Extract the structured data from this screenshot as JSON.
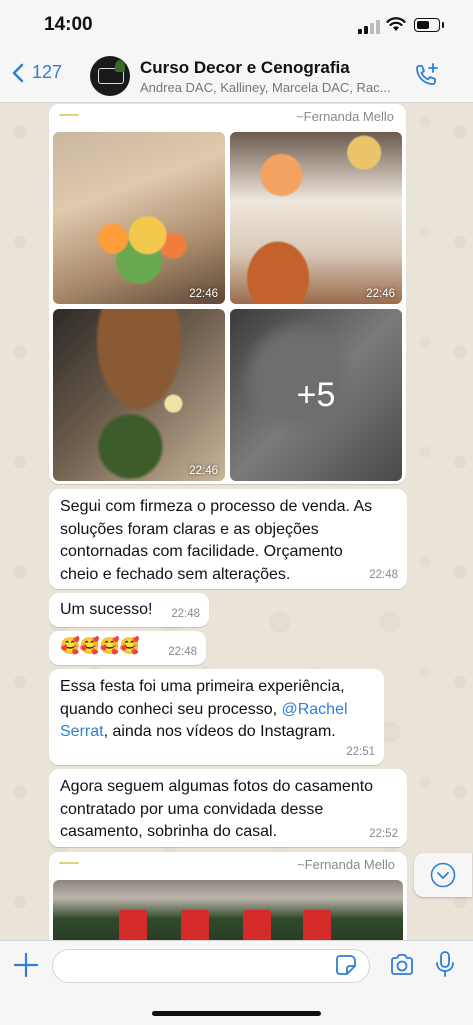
{
  "status_bar": {
    "time": "14:00",
    "battery_level": 0.6
  },
  "header": {
    "back_count": "127",
    "title": "Curso Decor e Cenografia",
    "subtitle": "Andrea DAC, Kalliney, Marcela DAC, Rac..."
  },
  "album1": {
    "sender": "~Fernanda Mello",
    "photos": [
      {
        "time": "22:46"
      },
      {
        "time": "22:46"
      },
      {
        "time": "22:46"
      },
      {
        "more": "+5"
      }
    ]
  },
  "messages": [
    {
      "lines": [
        "Segui com firmeza o processo de venda. As",
        "soluções foram claras e as objeções",
        "contornadas com facilidade. Orçamento",
        "cheio e fechado sem alterações."
      ],
      "time": "22:48"
    },
    {
      "text": "Um sucesso!",
      "time": "22:48"
    },
    {
      "text": "🥰🥰🥰🥰",
      "time": "22:48"
    },
    {
      "line1": "Essa festa foi uma primeira experiência,",
      "line2_pre": "quando conheci seu processo, ",
      "mention1": "@Rachel",
      "mention2": "Serrat",
      "line3_post": ", ainda nos vídeos do Instagram.",
      "time": "22:51"
    },
    {
      "lines": [
        "Agora seguem algumas fotos do casamento",
        "contratado por uma convidada desse",
        "casamento, sobrinha do casal."
      ],
      "time": "22:52"
    }
  ],
  "album2": {
    "sender": "~Fernanda Mello"
  },
  "colors": {
    "accent": "#2f7fd6",
    "bubble": "#ffffff",
    "chat_bg": "#e9e3d8"
  },
  "icons": [
    "chevron-left-icon",
    "add-call-icon",
    "plus-icon",
    "sticker-icon",
    "camera-icon",
    "microphone-icon",
    "chevron-down-icon"
  ]
}
